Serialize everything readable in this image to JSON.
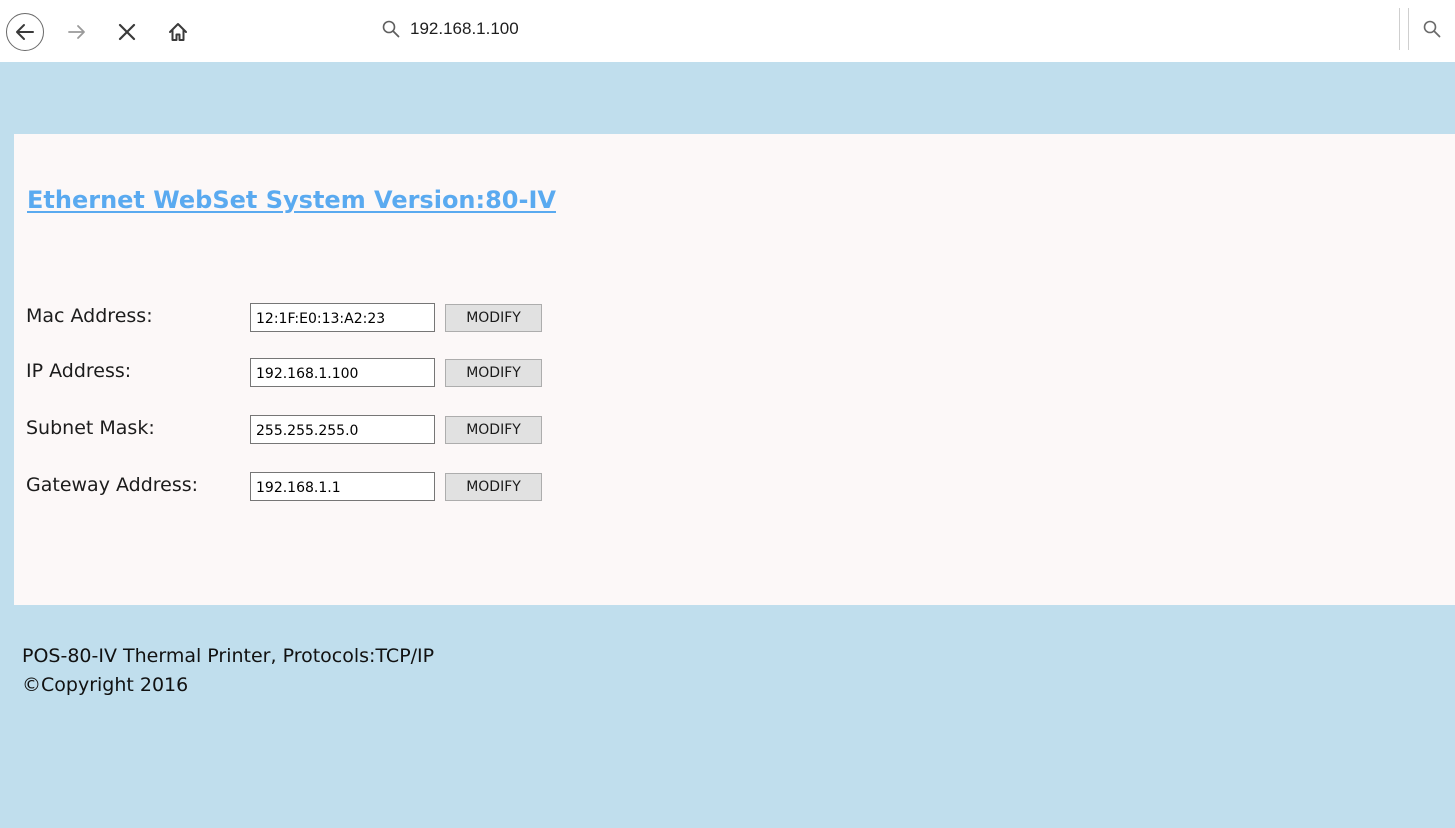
{
  "browser": {
    "url": "192.168.1.100",
    "icons": {
      "back": "back-arrow-icon",
      "forward": "forward-arrow-icon",
      "stop": "close-icon",
      "home": "home-icon",
      "search": "search-icon"
    }
  },
  "page": {
    "title": "Ethernet WebSet System Version:80-IV",
    "colors": {
      "background": "#c0deed",
      "panel": "#fcf8f8",
      "title": "#5aaaf0"
    },
    "fields": [
      {
        "label": "Mac Address:",
        "value": "12:1F:E0:13:A2:23",
        "button": "MODIFY"
      },
      {
        "label": "IP Address:",
        "value": "192.168.1.100",
        "button": "MODIFY"
      },
      {
        "label": "Subnet Mask:",
        "value": "255.255.255.0",
        "button": "MODIFY"
      },
      {
        "label": "Gateway Address:",
        "value": "192.168.1.1",
        "button": "MODIFY"
      }
    ],
    "footer": {
      "line1": "POS-80-IV Thermal Printer, Protocols:TCP/IP",
      "line2": "©Copyright 2016"
    }
  }
}
